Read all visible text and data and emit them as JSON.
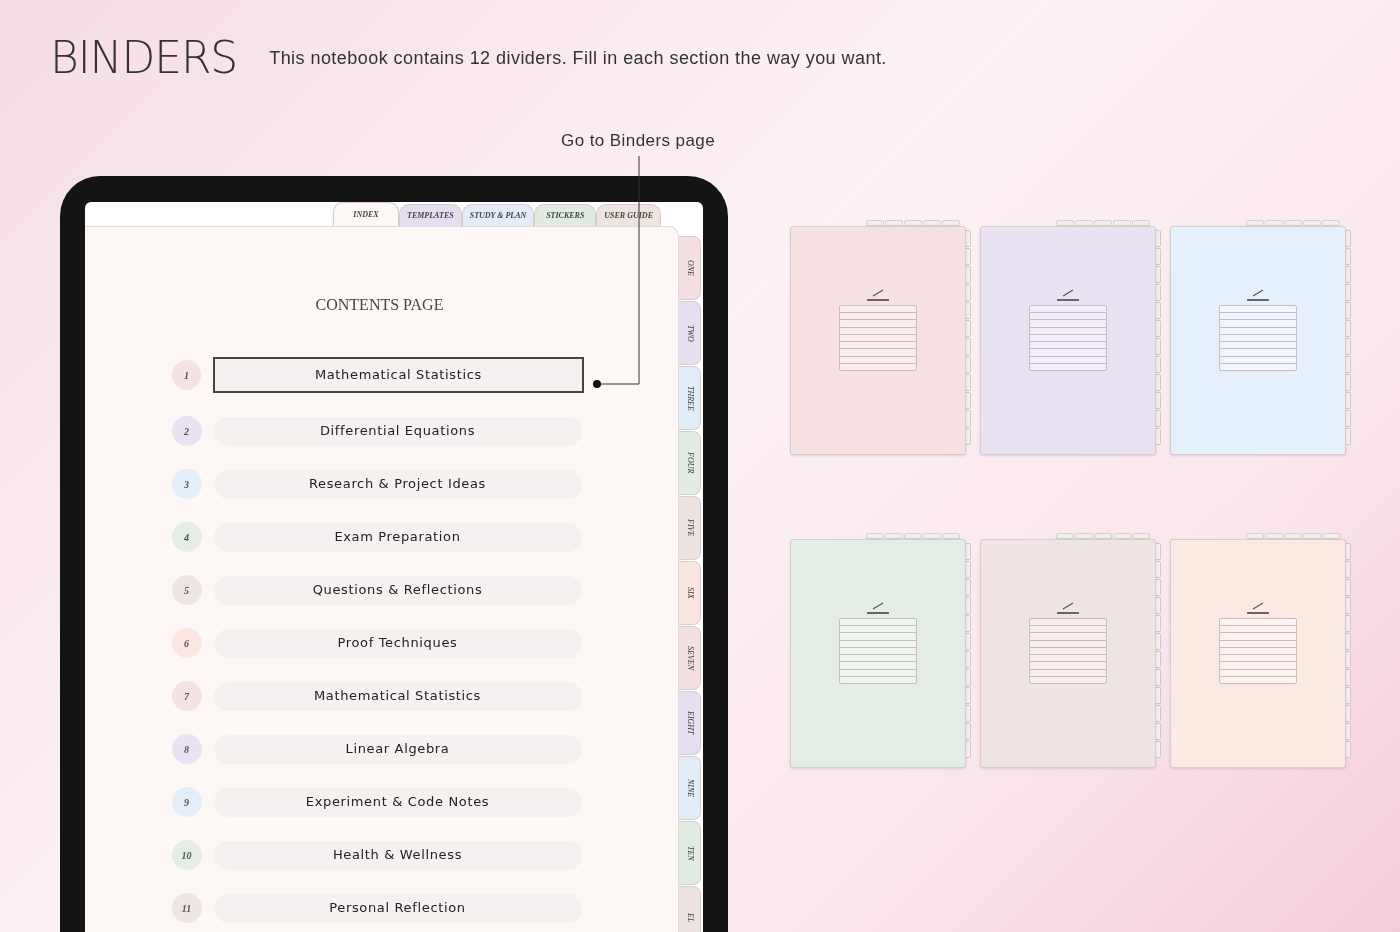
{
  "header": {
    "title": "BINDERS",
    "description": "This notebook contains 12 dividers. Fill in each section the way you want."
  },
  "callout": {
    "label": "Go to Binders page"
  },
  "top_tabs": [
    {
      "label": "INDEX",
      "selected": true,
      "color": "#fdf7f5"
    },
    {
      "label": "TEMPLATES",
      "selected": false,
      "color": "#e6def0"
    },
    {
      "label": "STUDY & PLAN",
      "selected": false,
      "color": "#e3ecf7"
    },
    {
      "label": "STICKERS",
      "selected": false,
      "color": "#e2ebe2"
    },
    {
      "label": "USER GUIDE",
      "selected": false,
      "color": "#ede3df"
    }
  ],
  "contents": {
    "title": "CONTENTS PAGE",
    "items": [
      {
        "number": "1",
        "label": "Mathematical Statistics",
        "selected": true,
        "color": "#f6e1e4"
      },
      {
        "number": "2",
        "label": "Differential Equations",
        "selected": false,
        "color": "#e8e2f3"
      },
      {
        "number": "3",
        "label": "Research & Project Ideas",
        "selected": false,
        "color": "#e4eefa"
      },
      {
        "number": "4",
        "label": "Exam Preparation",
        "selected": false,
        "color": "#e4ede6"
      },
      {
        "number": "5",
        "label": "Questions & Reflections",
        "selected": false,
        "color": "#eee6e2"
      },
      {
        "number": "6",
        "label": "Proof Techniques",
        "selected": false,
        "color": "#fbe6e2"
      },
      {
        "number": "7",
        "label": "Mathematical Statistics",
        "selected": false,
        "color": "#f6e1e4"
      },
      {
        "number": "8",
        "label": "Linear Algebra",
        "selected": false,
        "color": "#e8e2f3"
      },
      {
        "number": "9",
        "label": "Experiment & Code Notes",
        "selected": false,
        "color": "#e4eefa"
      },
      {
        "number": "10",
        "label": "Health & Wellness",
        "selected": false,
        "color": "#e4ede6"
      },
      {
        "number": "11",
        "label": "Personal Reflection",
        "selected": false,
        "color": "#eee6e2"
      }
    ]
  },
  "side_tabs": [
    {
      "label": "ONE",
      "color": "#f6dfe2"
    },
    {
      "label": "TWO",
      "color": "#e6dff1"
    },
    {
      "label": "THREE",
      "color": "#e2edfa"
    },
    {
      "label": "FOUR",
      "color": "#e1ece3"
    },
    {
      "label": "FIVE",
      "color": "#ede4e0"
    },
    {
      "label": "SIX",
      "color": "#fbe5e0"
    },
    {
      "label": "SEVEN",
      "color": "#f6dfe2"
    },
    {
      "label": "EIGHT",
      "color": "#e6dff1"
    },
    {
      "label": "NINE",
      "color": "#e2edfa"
    },
    {
      "label": "TEN",
      "color": "#e1ece3"
    },
    {
      "label": "EL",
      "color": "#ede4e0"
    }
  ],
  "binder_pages": [
    {
      "color": "#f8e1e3"
    },
    {
      "color": "#e9e2f3"
    },
    {
      "color": "#e6f0fc"
    },
    {
      "color": "#e4eee6"
    },
    {
      "color": "#efe6e3"
    },
    {
      "color": "#fce9e4"
    }
  ]
}
